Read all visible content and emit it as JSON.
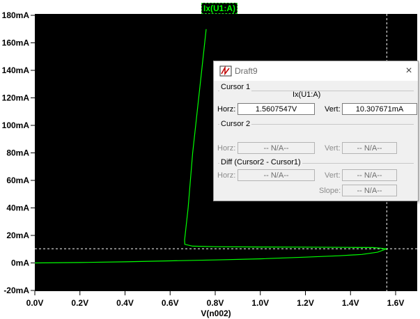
{
  "chart_data": {
    "type": "line",
    "xlabel": "V(n002)",
    "x_ticks": [
      "0.0V",
      "0.2V",
      "0.4V",
      "0.6V",
      "0.8V",
      "1.0V",
      "1.2V",
      "1.4V",
      "1.6V"
    ],
    "x_tick_values": [
      0.0,
      0.2,
      0.4,
      0.6,
      0.8,
      1.0,
      1.2,
      1.4,
      1.6
    ],
    "y_ticks": [
      "180mA",
      "160mA",
      "140mA",
      "120mA",
      "100mA",
      "80mA",
      "60mA",
      "40mA",
      "20mA",
      "0mA",
      "-20mA"
    ],
    "y_tick_values": [
      180,
      160,
      140,
      120,
      100,
      80,
      60,
      40,
      20,
      0,
      -20
    ],
    "xlim": [
      0.0,
      1.63
    ],
    "ylim": [
      -20,
      182
    ],
    "series": [
      {
        "name": "Ix(U1:A)",
        "color": "#00ff00",
        "points": [
          [
            0.0,
            0.0
          ],
          [
            0.2,
            0.3
          ],
          [
            0.4,
            0.8
          ],
          [
            0.6,
            1.5
          ],
          [
            0.8,
            2.2
          ],
          [
            1.0,
            3.0
          ],
          [
            1.2,
            4.2
          ],
          [
            1.35,
            5.2
          ],
          [
            1.45,
            6.2
          ],
          [
            1.52,
            7.8
          ],
          [
            1.5608,
            10.3
          ],
          [
            1.5,
            11.2
          ],
          [
            1.4,
            11.3
          ],
          [
            1.2,
            11.5
          ],
          [
            1.0,
            11.6
          ],
          [
            0.8,
            11.8
          ],
          [
            0.7,
            12.2
          ],
          [
            0.665,
            13.5
          ],
          [
            0.664,
            16.5
          ],
          [
            0.68,
            40
          ],
          [
            0.7,
            80
          ],
          [
            0.72,
            110
          ],
          [
            0.74,
            140
          ],
          [
            0.76,
            170
          ]
        ]
      }
    ],
    "cursor": {
      "x": 1.5608,
      "y": 10.3
    }
  },
  "colors": {
    "plot_bg": "#000000",
    "trace": "#00ff00",
    "axis_text": "#000000"
  },
  "dialog": {
    "title": "Draft9",
    "close_glyph": "×",
    "cursor1": {
      "title": "Cursor 1",
      "trace": "Ix(U1:A)",
      "horz_label": "Horz:",
      "horz_value": "1.5607547V",
      "vert_label": "Vert:",
      "vert_value": "10.307671mA"
    },
    "cursor2": {
      "title": "Cursor 2",
      "horz_label": "Horz:",
      "horz_value": "-- N/A--",
      "vert_label": "Vert:",
      "vert_value": "-- N/A--"
    },
    "diff": {
      "title": "Diff (Cursor2 - Cursor1)",
      "horz_label": "Horz:",
      "horz_value": "-- N/A--",
      "vert_label": "Vert:",
      "vert_value": "-- N/A--",
      "slope_label": "Slope:",
      "slope_value": "-- N/A--"
    }
  }
}
